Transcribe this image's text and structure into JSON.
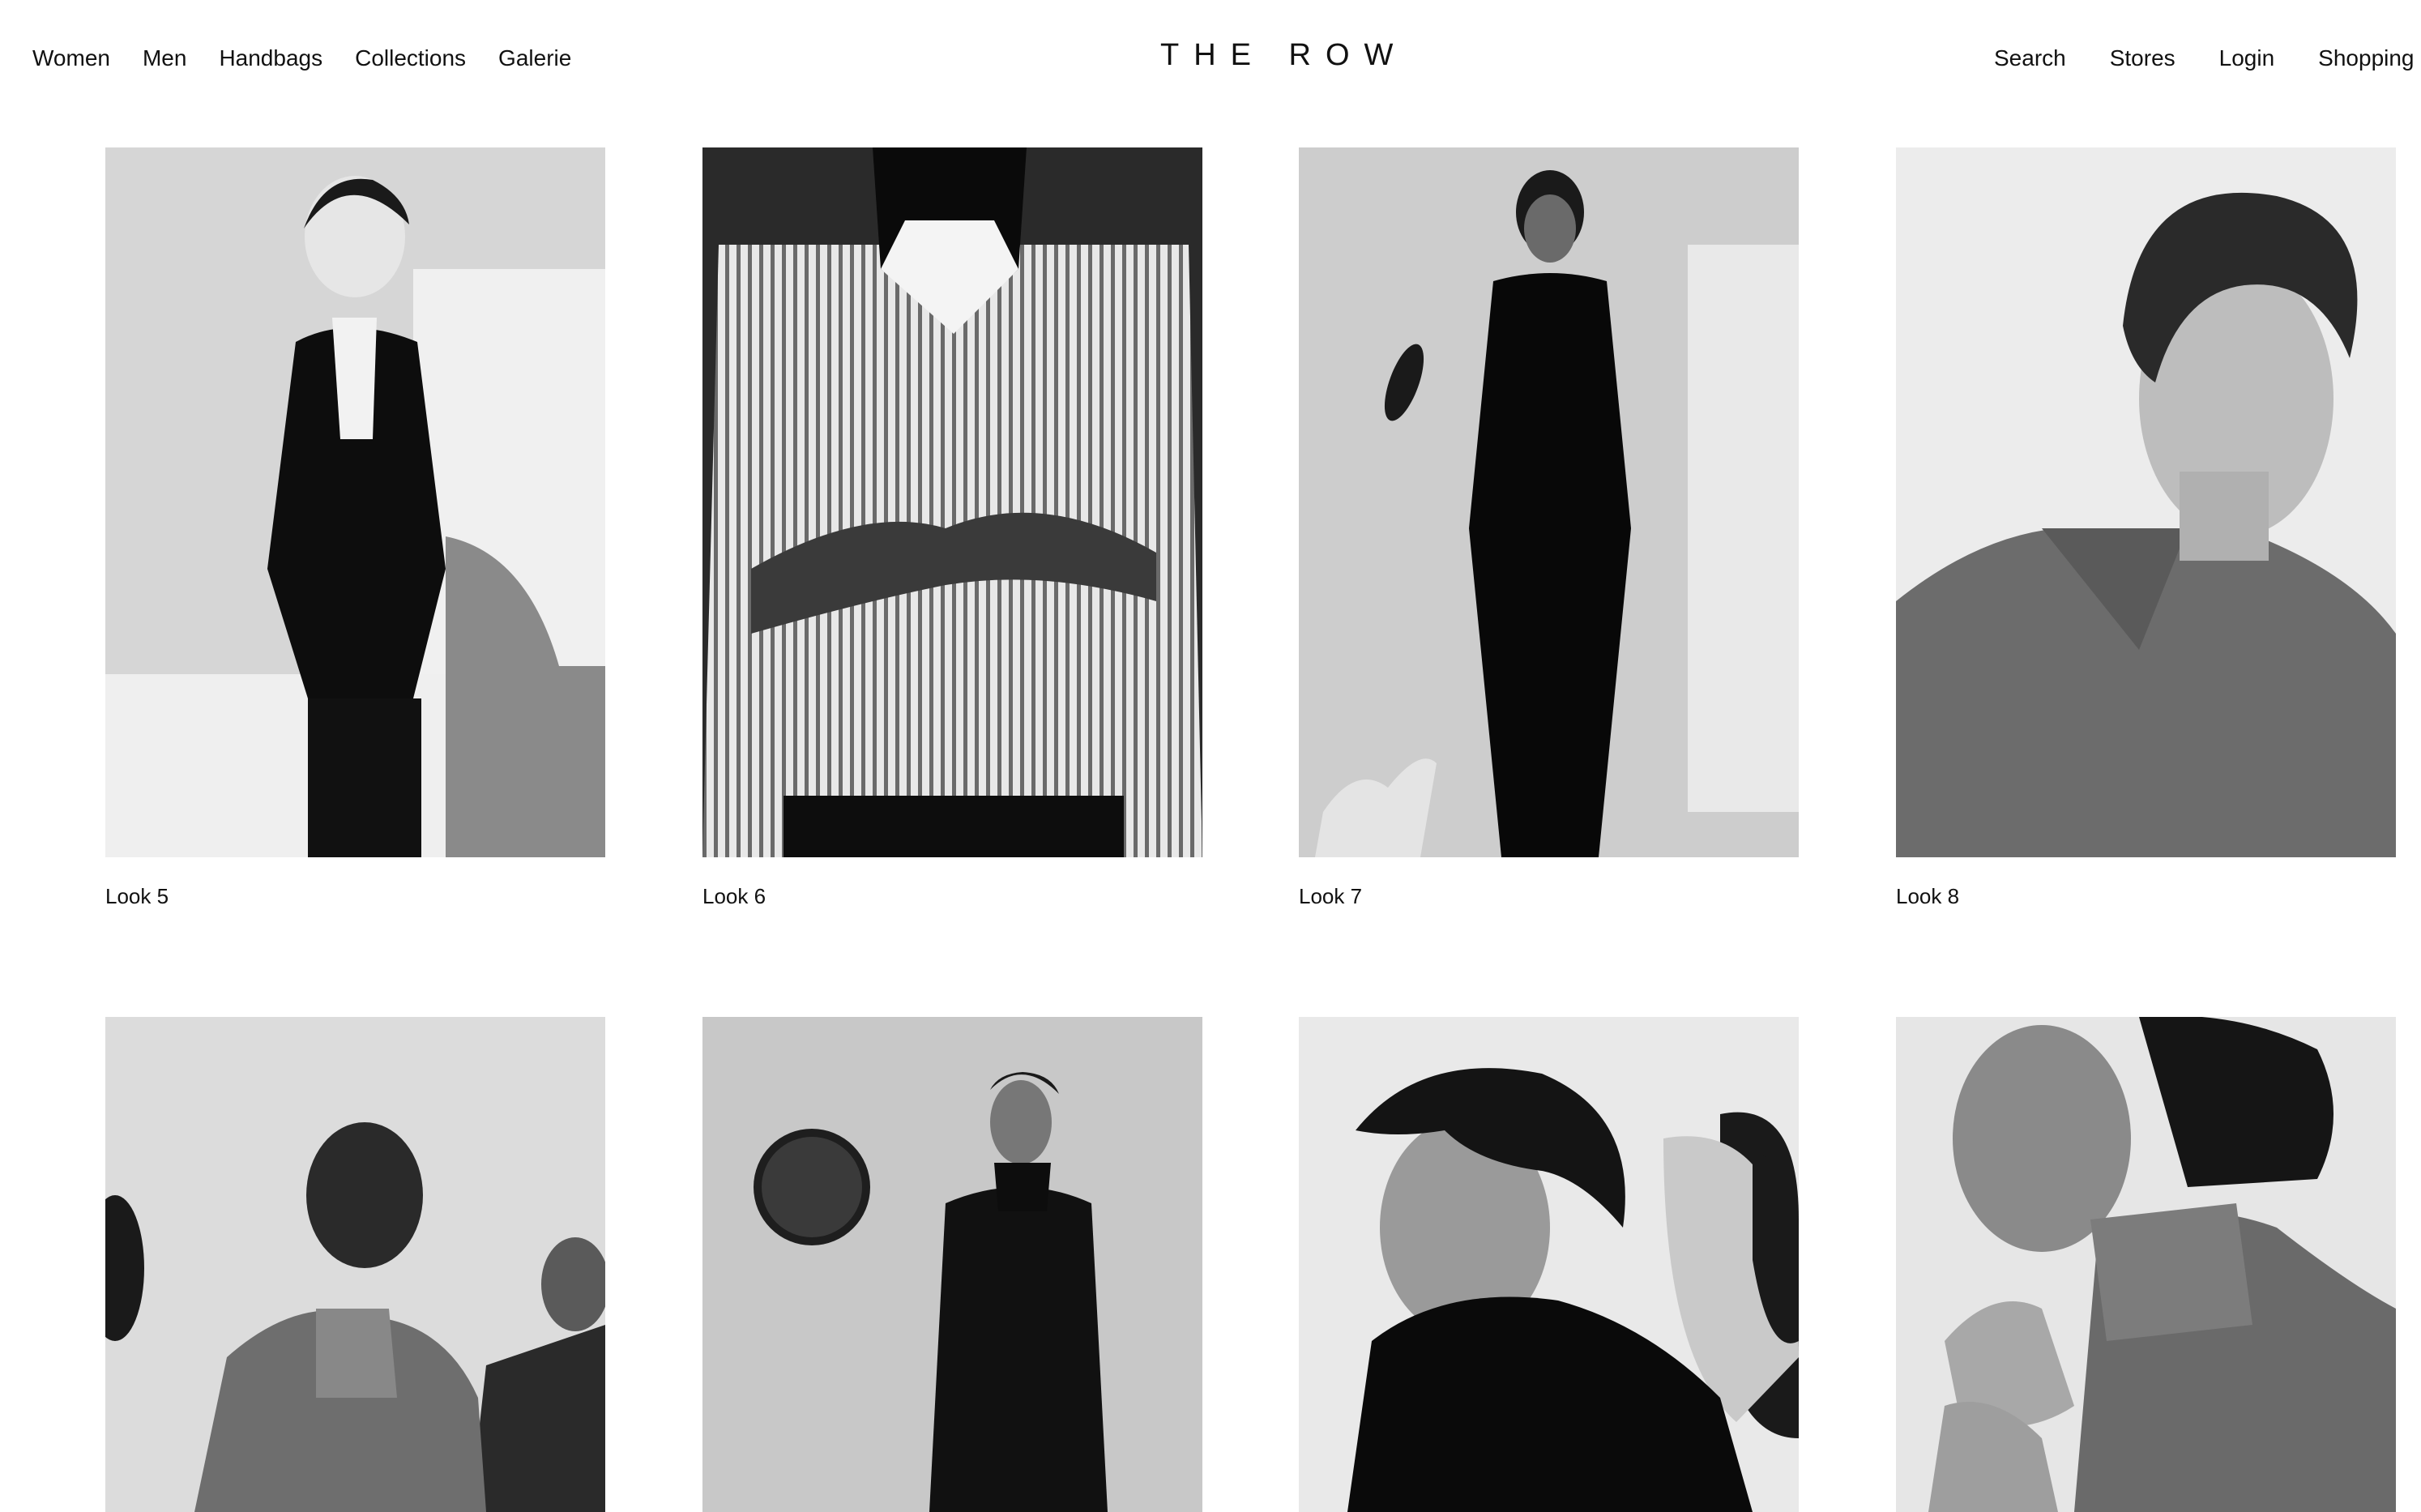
{
  "header": {
    "nav_left": [
      "Women",
      "Men",
      "Handbags",
      "Collections",
      "Galerie"
    ],
    "logo": "THE ROW",
    "nav_right": [
      "Search",
      "Stores",
      "Login",
      "Shopping ba"
    ]
  },
  "looks_row1": [
    {
      "label": "Look 5",
      "image": "model-in-black-jacket-white-shirt"
    },
    {
      "label": "Look 6",
      "image": "striped-shirt-closeup-hands"
    },
    {
      "label": "Look 7",
      "image": "model-in-black-suit-full-length"
    },
    {
      "label": "Look 8",
      "image": "profile-portrait-grey-polo"
    }
  ],
  "looks_row2": [
    {
      "image": "two-models-coats-side-view"
    },
    {
      "image": "model-in-black-coat-round-mirror"
    },
    {
      "image": "profile-black-turtleneck-mirror"
    },
    {
      "image": "profile-grey-turtleneck-tweed-jacket"
    }
  ]
}
